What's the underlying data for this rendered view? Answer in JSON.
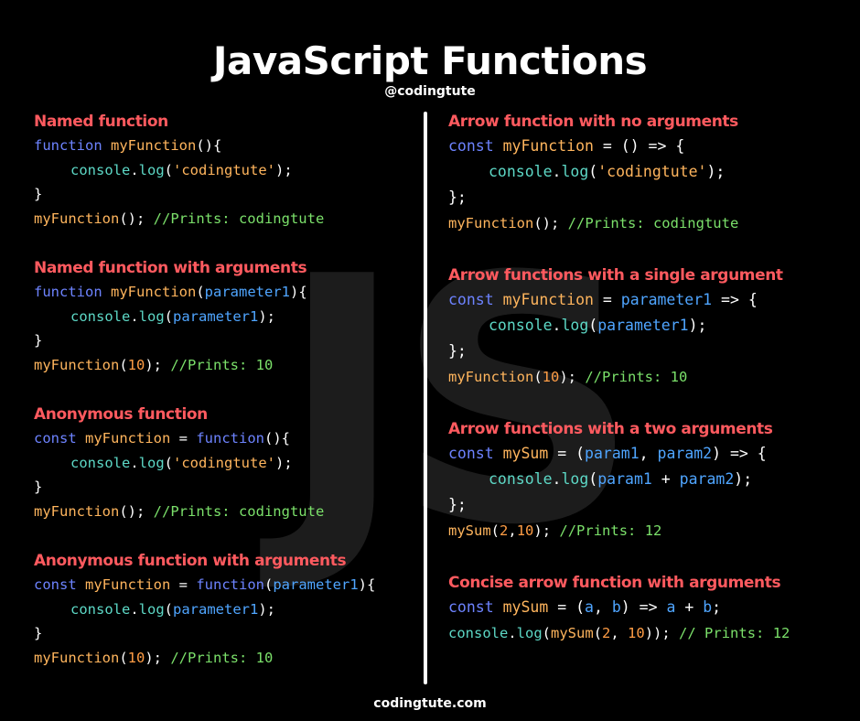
{
  "header": {
    "title": "JavaScript Functions",
    "handle": "@codingtute"
  },
  "footer": {
    "site": "codingtute.com"
  },
  "watermark": "JS",
  "colors": {
    "background": "#000000",
    "section_title": "#ff5a5f",
    "keyword": "#6d83ff",
    "function_name": "#ffb55d",
    "parameter": "#4fa5ff",
    "console": "#5dd8c6",
    "comment": "#7be06a"
  },
  "sections": {
    "named": {
      "title": "Named function"
    },
    "named_args": {
      "title": "Named function with arguments"
    },
    "anon": {
      "title": "Anonymous function"
    },
    "anon_args": {
      "title": "Anonymous function with arguments"
    },
    "arrow_none": {
      "title": "Arrow function with no arguments"
    },
    "arrow_single": {
      "title": "Arrow functions with a single argument"
    },
    "arrow_two": {
      "title": "Arrow functions with a two arguments"
    },
    "concise": {
      "title": "Concise arrow function with arguments"
    }
  },
  "tokens": {
    "function": "function",
    "const": "const",
    "myFunction": "myFunction",
    "mySum": "mySum",
    "console": "console",
    "log": "log",
    "parameter1": "parameter1",
    "param1": "param1",
    "param2": "param2",
    "a": "a",
    "b": "b",
    "string": "'codingtute'",
    "n10": "10",
    "n2": "2",
    "comment_codingtute": "//Prints: codingtute",
    "comment_10": "//Prints: 10",
    "comment_12": "//Prints: 12",
    "comment_12_spaced": "// Prints: 12"
  }
}
